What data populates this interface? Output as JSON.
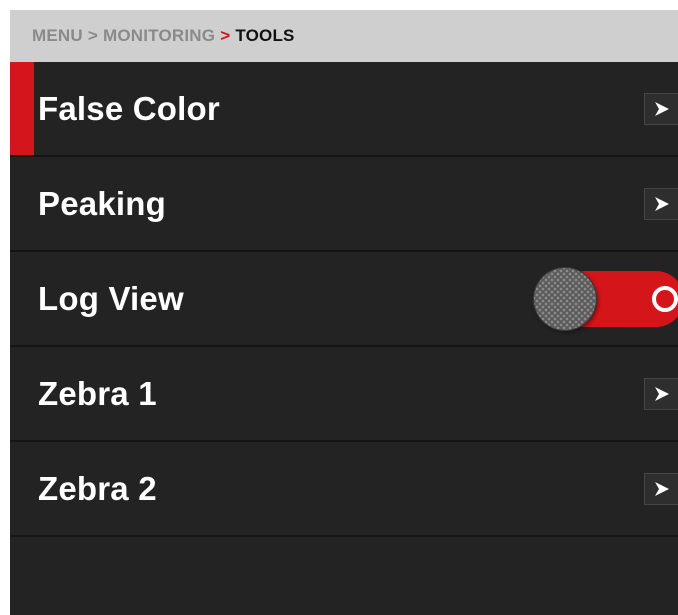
{
  "breadcrumb": {
    "items": [
      "MENU",
      "MONITORING"
    ],
    "current": "TOOLS",
    "separator": ">"
  },
  "menu": {
    "items": [
      {
        "label": "False Color",
        "control": "chevron",
        "selected": true
      },
      {
        "label": "Peaking",
        "control": "chevron",
        "selected": false
      },
      {
        "label": "Log View",
        "control": "toggle",
        "toggle_state": "on",
        "selected": false
      },
      {
        "label": "Zebra 1",
        "control": "chevron",
        "selected": false
      },
      {
        "label": "Zebra 2",
        "control": "chevron",
        "selected": false
      }
    ]
  },
  "colors": {
    "accent": "#d4161b",
    "background": "#232323",
    "breadcrumb_bar": "#cfcfcf",
    "text": "#ffffff"
  },
  "icons": {
    "chevron": "chevron-right-icon",
    "toggle_on": "toggle-on-ring-icon"
  }
}
